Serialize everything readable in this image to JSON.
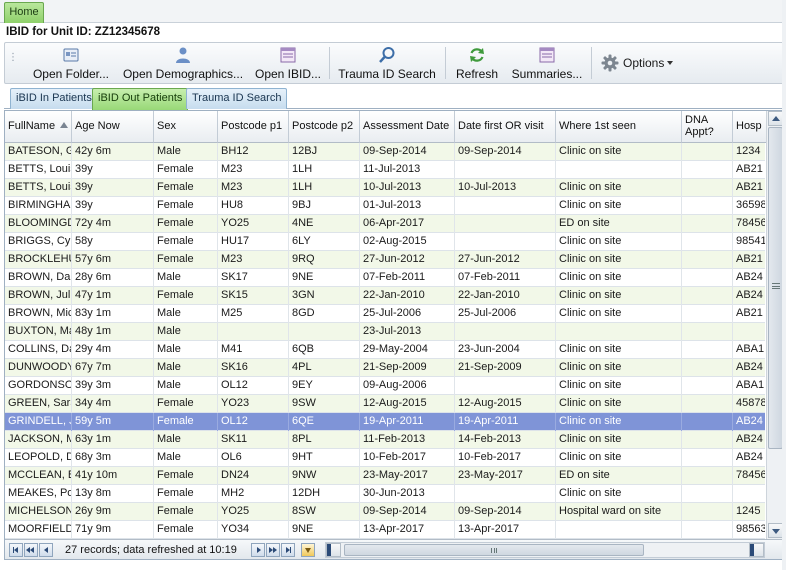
{
  "ribbon": {
    "home_tab": "Home"
  },
  "unit_title": "IBID for Unit ID: ZZ12345678",
  "toolbar": {
    "open_folder": "Open Folder...",
    "open_demographics": "Open Demographics...",
    "open_ibid": "Open IBID...",
    "trauma_id_search": "Trauma ID Search",
    "refresh": "Refresh",
    "summaries": "Summaries...",
    "options": "Options"
  },
  "subtabs": [
    {
      "label": "iBID In Patients",
      "active": false
    },
    {
      "label": "iBID Out Patients",
      "active": true
    },
    {
      "label": "Trauma ID Search",
      "active": false
    }
  ],
  "grid": {
    "columns": [
      {
        "label": "FullName",
        "sort": "asc"
      },
      {
        "label": "Age Now"
      },
      {
        "label": "Sex"
      },
      {
        "label": "Postcode p1"
      },
      {
        "label": "Postcode p2"
      },
      {
        "label": "Assessment Date"
      },
      {
        "label": "Date first OR visit"
      },
      {
        "label": "Where 1st seen"
      },
      {
        "label": "DNA Appt?"
      },
      {
        "label": "Hosp"
      }
    ],
    "selected_row": 15,
    "rows": [
      [
        "BATESON, Ga",
        "42y 6m",
        "Male",
        "BH12",
        "12BJ",
        "09-Sep-2014",
        "09-Sep-2014",
        "Clinic on site",
        "",
        "1234"
      ],
      [
        "BETTS, Louis",
        "39y",
        "Female",
        "M23",
        "1LH",
        "11-Jul-2013",
        "",
        "",
        "",
        "AB21"
      ],
      [
        "BETTS, Louis",
        "39y",
        "Female",
        "M23",
        "1LH",
        "10-Jul-2013",
        "10-Jul-2013",
        "Clinic on site",
        "",
        "AB21"
      ],
      [
        "BIRMINGHAM",
        "39y",
        "Female",
        "HU8",
        "9BJ",
        "01-Jul-2013",
        "",
        "Clinic on site",
        "",
        "36598"
      ],
      [
        "BLOOMINGDA",
        "72y 4m",
        "Female",
        "YO25",
        "4NE",
        "06-Apr-2017",
        "",
        "ED on site",
        "",
        "78456"
      ],
      [
        "BRIGGS, Cyn",
        "58y",
        "Female",
        "HU17",
        "6LY",
        "02-Aug-2015",
        "",
        "Clinic on site",
        "",
        "98541"
      ],
      [
        "BROCKLEHUR",
        "57y 6m",
        "Female",
        "M23",
        "9RQ",
        "27-Jun-2012",
        "27-Jun-2012",
        "Clinic on site",
        "",
        "AB21"
      ],
      [
        "BROWN, Dar",
        "28y 6m",
        "Male",
        "SK17",
        "9NE",
        "07-Feb-2011",
        "07-Feb-2011",
        "Clinic on site",
        "",
        "AB24"
      ],
      [
        "BROWN, Julia",
        "47y 1m",
        "Female",
        "SK15",
        "3GN",
        "22-Jan-2010",
        "22-Jan-2010",
        "Clinic on site",
        "",
        "AB24"
      ],
      [
        "BROWN, Mich",
        "83y 1m",
        "Male",
        "M25",
        "8GD",
        "25-Jul-2006",
        "25-Jul-2006",
        "Clinic on site",
        "",
        "AB21"
      ],
      [
        "BUXTON, Ma",
        "48y 1m",
        "Male",
        "",
        "",
        "23-Jul-2013",
        "",
        "",
        "",
        ""
      ],
      [
        "COLLINS, Da",
        "29y 4m",
        "Male",
        "M41",
        "6QB",
        "29-May-2004",
        "23-Jun-2004",
        "Clinic on site",
        "",
        "ABA1"
      ],
      [
        "DUNWOODY,",
        "67y 7m",
        "Male",
        "SK16",
        "4PL",
        "21-Sep-2009",
        "21-Sep-2009",
        "Clinic on site",
        "",
        "AB24"
      ],
      [
        "GORDONSON",
        "39y 3m",
        "Male",
        "OL12",
        "9EY",
        "09-Aug-2006",
        "",
        "Clinic on site",
        "",
        "ABA1"
      ],
      [
        "GREEN, Sara",
        "34y 4m",
        "Female",
        "YO23",
        "9SW",
        "12-Aug-2015",
        "12-Aug-2015",
        "Clinic on site",
        "",
        "45878"
      ],
      [
        "GRINDELL, Ja",
        "59y 5m",
        "Female",
        "OL12",
        "6QE",
        "19-Apr-2011",
        "19-Apr-2011",
        "Clinic on site",
        "",
        "AB24"
      ],
      [
        "JACKSON, M.",
        "63y 1m",
        "Male",
        "SK11",
        "8PL",
        "11-Feb-2013",
        "14-Feb-2013",
        "Clinic on site",
        "",
        "AB24"
      ],
      [
        "LEOPOLD, Da",
        "68y 3m",
        "Male",
        "OL6",
        "9HT",
        "10-Feb-2017",
        "10-Feb-2017",
        "Clinic on site",
        "",
        "AB24"
      ],
      [
        "MCCLEAN, Bi",
        "41y 10m",
        "Female",
        "DN24",
        "9NW",
        "23-May-2017",
        "23-May-2017",
        "ED on site",
        "",
        "78456"
      ],
      [
        "MEAKES, Pop",
        "13y 8m",
        "Female",
        "MH2",
        "12DH",
        "30-Jun-2013",
        "",
        "Clinic on site",
        "",
        ""
      ],
      [
        "MICHELSON",
        "26y 9m",
        "Female",
        "YO25",
        "8SW",
        "09-Sep-2014",
        "09-Sep-2014",
        "Hospital ward on site",
        "",
        "1245"
      ],
      [
        "MOORFIELD,",
        "71y 9m",
        "Female",
        "YO34",
        "9NE",
        "13-Apr-2017",
        "13-Apr-2017",
        "",
        "",
        "98563"
      ]
    ]
  },
  "footer": {
    "records_text": "27 records; data refreshed at 10:19"
  }
}
